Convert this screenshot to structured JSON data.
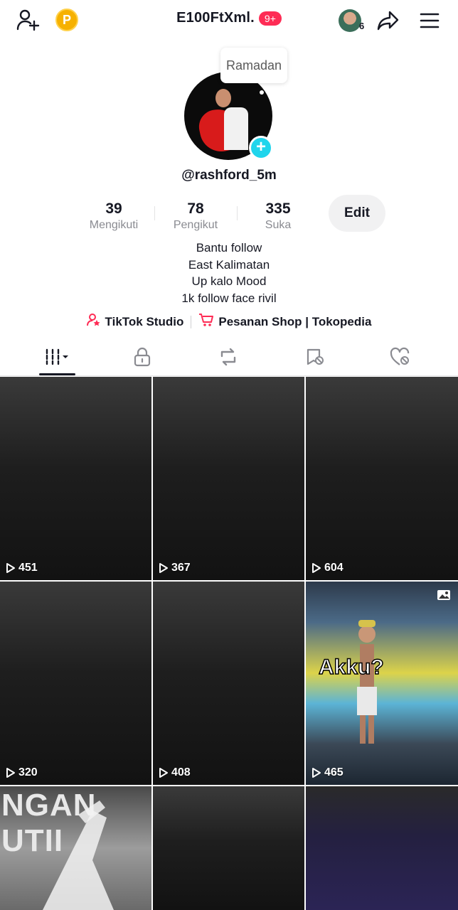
{
  "header": {
    "title": "E100FtXml.",
    "badge": "9+",
    "coin_label": "P",
    "friend_count": "6",
    "icons": [
      "add-user-icon",
      "coin-icon",
      "friends-avatar",
      "share-icon",
      "menu-icon"
    ]
  },
  "profile": {
    "bubble_text": "Ramadan",
    "username": "@rashford_5m",
    "stats": [
      {
        "value": "39",
        "label": "Mengikuti"
      },
      {
        "value": "78",
        "label": "Pengikut"
      },
      {
        "value": "335",
        "label": "Suka"
      }
    ],
    "edit_label": "Edit",
    "bio": [
      "Bantu follow",
      "East Kalimatan",
      "Up kalo Mood",
      "1k follow face rivil"
    ],
    "links": [
      {
        "label": "TikTok Studio",
        "icon": "studio-icon"
      },
      {
        "label": "Pesanan Shop | Tokopedia",
        "icon": "cart-icon"
      }
    ],
    "accent": "#fe2c55"
  },
  "tabs": [
    {
      "name": "videos",
      "icon": "grid-icon",
      "selected": true
    },
    {
      "name": "private",
      "icon": "lock-icon"
    },
    {
      "name": "reposts",
      "icon": "repost-icon"
    },
    {
      "name": "favorites",
      "icon": "bookmark-icon"
    },
    {
      "name": "liked",
      "icon": "heart-icon"
    }
  ],
  "videos": [
    {
      "views": "451"
    },
    {
      "views": "367"
    },
    {
      "views": "604"
    },
    {
      "views": "320"
    },
    {
      "views": "408"
    },
    {
      "views": "465",
      "caption": "Akku?"
    },
    {
      "text": "NGAN UTII"
    },
    {},
    {}
  ]
}
